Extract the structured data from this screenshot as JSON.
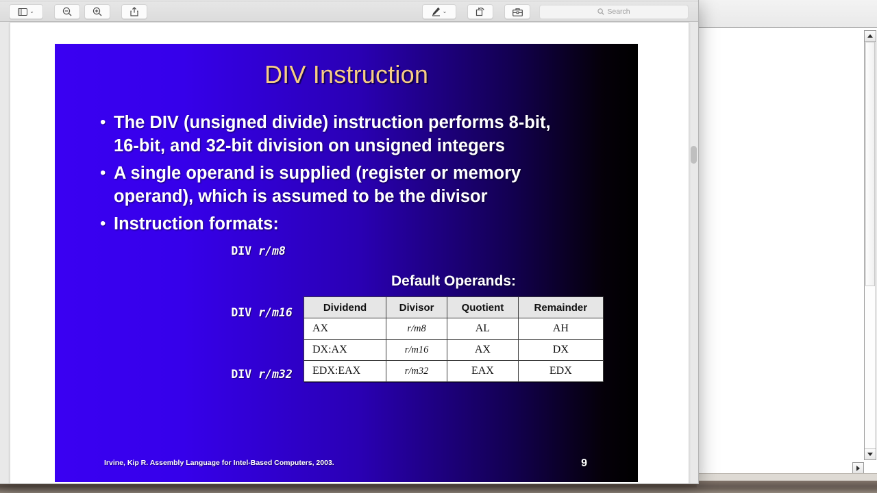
{
  "window": {
    "title": "",
    "app": "Preview"
  },
  "toolbar": {
    "sidebar_button": {
      "icon": "sidebar-icon",
      "chevron": "⌄"
    },
    "zoom_out_button": {
      "icon": "zoom-out-icon",
      "label": "Zoom Out"
    },
    "zoom_in_button": {
      "icon": "zoom-in-icon",
      "label": "Zoom In"
    },
    "share_button": {
      "icon": "share-icon",
      "label": "Share"
    },
    "markup_button": {
      "icon": "pen-icon",
      "chevron": "⌄"
    },
    "rotate_button": {
      "icon": "rotate-icon",
      "label": "Rotate"
    },
    "toolbox_button": {
      "icon": "toolbox-icon",
      "label": "Markup Toolbar"
    },
    "search": {
      "icon": "search-icon",
      "placeholder": "Search",
      "value": ""
    }
  },
  "slide": {
    "title": "DIV Instruction",
    "bullet_glyph": "•",
    "bullets": [
      "The DIV (unsigned divide) instruction performs 8-bit, 16-bit, and 32-bit division on unsigned integers",
      "A single operand is supplied (register or memory operand), which is assumed to be the divisor",
      "Instruction formats:"
    ],
    "code_lines": [
      {
        "mnemonic": "DIV",
        "operand": "r/m8"
      },
      {
        "mnemonic": "DIV",
        "operand": "r/m16"
      },
      {
        "mnemonic": "DIV",
        "operand": "r/m32"
      }
    ],
    "operands_caption": "Default Operands:",
    "table": {
      "headers": [
        "Dividend",
        "Divisor",
        "Quotient",
        "Remainder"
      ],
      "rows": [
        [
          "AX",
          "r/m8",
          "AL",
          "AH"
        ],
        [
          "DX:AX",
          "r/m16",
          "AX",
          "DX"
        ],
        [
          "EDX:EAX",
          "r/m32",
          "EAX",
          "EDX"
        ]
      ]
    },
    "footer": "Irvine, Kip R. Assembly Language for Intel-Based Computers, 2003.",
    "page_number": "9",
    "colors": {
      "title_gold": "#f7cd85",
      "bg_left": "#3a00f2",
      "bg_right": "#000000",
      "text": "#ffffff",
      "table_header_bg": "#e6e6e6"
    }
  },
  "background_window": {
    "scrollbar": {
      "up_arrow": "▲",
      "down_arrow": "▼",
      "right_arrow": "▶"
    }
  }
}
